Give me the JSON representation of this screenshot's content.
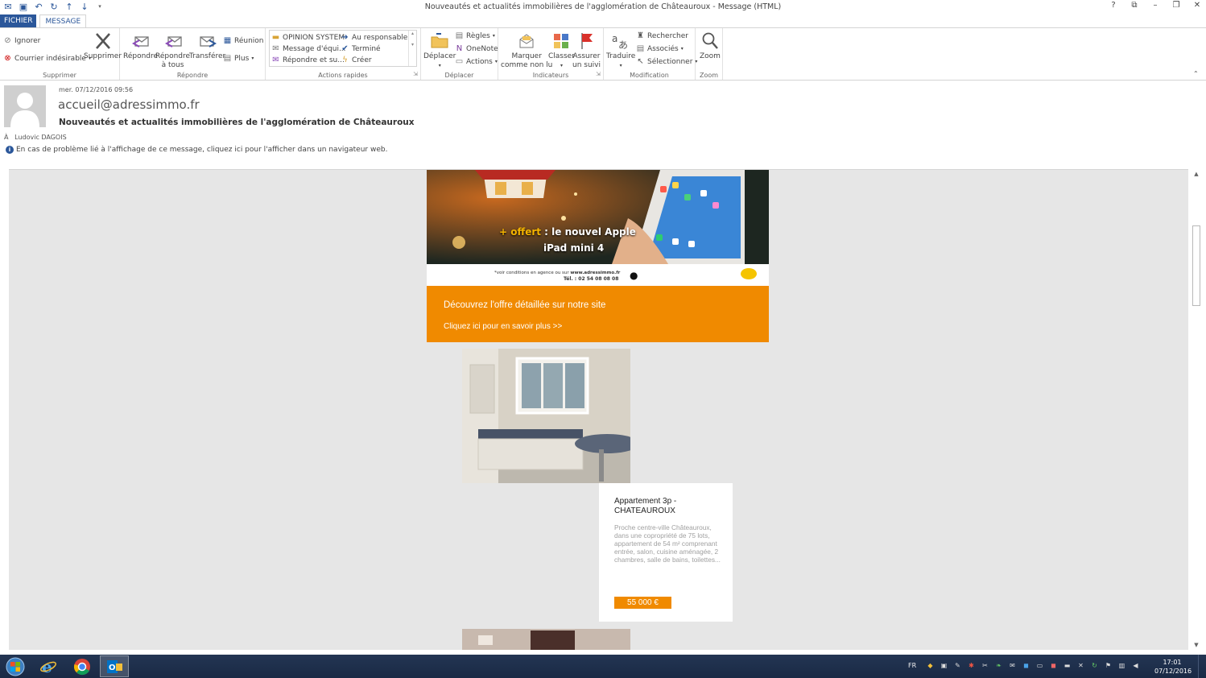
{
  "window": {
    "title": "Nouveautés et actualités immobilières de l'agglomération de Châteauroux - Message (HTML)",
    "controls": [
      "?",
      "⧉",
      "–",
      "❐",
      "✕"
    ]
  },
  "tabs": {
    "file": "FICHIER",
    "message": "MESSAGE"
  },
  "ribbon": {
    "supprimer": {
      "label": "Supprimer",
      "ignorer": "Ignorer",
      "courrier": "Courrier indésirable",
      "supprimer_btn": "Supprimer"
    },
    "repondre": {
      "label": "Répondre",
      "repondre": "Répondre",
      "repondre_tous_1": "Répondre",
      "repondre_tous_2": "à tous",
      "transferer": "Transférer",
      "reunion": "Réunion",
      "plus": "Plus"
    },
    "actions_rapides": {
      "label": "Actions rapides",
      "items": [
        "OPINION SYSTEM",
        "Message d'équi...",
        "Répondre et su...",
        "Au responsable",
        "Terminé",
        "Créer"
      ]
    },
    "deplacer": {
      "label": "Déplacer",
      "deplacer": "Déplacer",
      "regles": "Règles",
      "onenote": "OneNote",
      "actions": "Actions"
    },
    "indicateurs": {
      "label": "Indicateurs",
      "marquer_1": "Marquer",
      "marquer_2": "comme non lu",
      "classer": "Classer",
      "assurer_1": "Assurer",
      "assurer_2": "un suivi"
    },
    "modification": {
      "label": "Modification",
      "traduire": "Traduire",
      "rechercher": "Rechercher",
      "associes": "Associés",
      "selectionner": "Sélectionner"
    },
    "zoom": {
      "label": "Zoom",
      "zoom": "Zoom"
    }
  },
  "header": {
    "date": "mer. 07/12/2016 09:56",
    "from": "accueil@adressimmo.fr",
    "subject": "Nouveautés et actualités immobilières de l'agglomération de Châteauroux",
    "to_label": "À",
    "to": "Ludovic DAGOIS",
    "info": "En cas de problème lié à l'affichage de ce message, cliquez ici pour l'afficher dans un navigateur web."
  },
  "email": {
    "banner": {
      "offer_plus": "+ offert",
      "offer_rest": " : le nouvel Apple",
      "product": "iPad mini 4",
      "conditions": "*voir conditions en agence ou sur",
      "site": "www.adressimmo.fr",
      "tel": "Tél. : 02 54 08 08 08"
    },
    "cta": {
      "title": "Découvrez l'offre détaillée sur notre site",
      "link": "Cliquez ici pour en savoir plus >>"
    },
    "listing": {
      "title": "Appartement 3p - CHATEAUROUX",
      "description": "Proche centre-ville Châteauroux, dans une copropriété de 75 lots, appartement de 54 m² comprenant entrée, salon, cuisine aménagée, 2 chambres, salle de bains, toilettes...",
      "price": "55 000 €"
    }
  },
  "taskbar": {
    "lang": "FR",
    "time": "17:01",
    "date": "07/12/2016"
  },
  "colors": {
    "accent": "#2b579a",
    "orange": "#f08a00"
  }
}
